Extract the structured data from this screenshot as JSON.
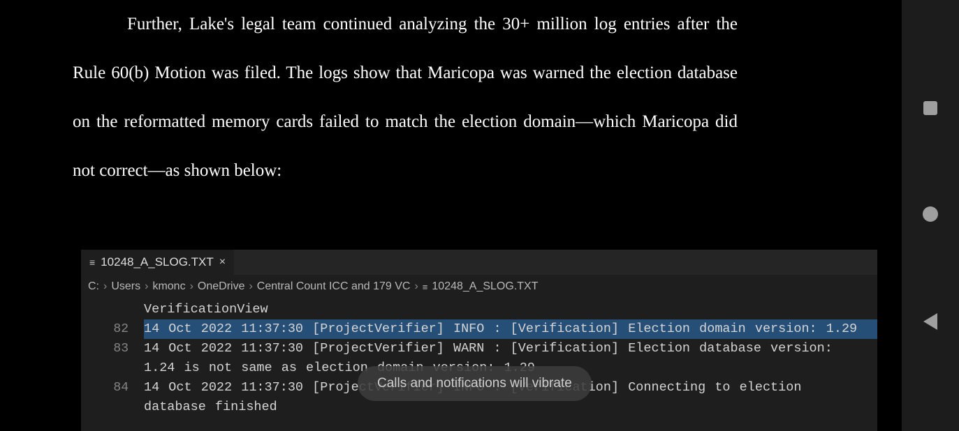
{
  "paragraph": {
    "text": "Further, Lake's legal team continued analyzing the 30+ million log entries after the Rule 60(b) Motion was filed. The logs show that Maricopa was warned the election database on the reformatted memory cards failed to match the election domain—which Maricopa did not correct—as shown below:"
  },
  "editor": {
    "tab": {
      "filename": "10248_A_SLOG.TXT"
    },
    "breadcrumbs": [
      "C:",
      "Users",
      "kmonc",
      "OneDrive",
      "Central Count ICC and 179 VC",
      "10248_A_SLOG.TXT"
    ],
    "lines": [
      {
        "num": "",
        "text": "VerificationView",
        "highlight": false,
        "cutoff": true
      },
      {
        "num": "82",
        "text": "14 Oct 2022 11:37:30 [ProjectVerifier] INFO : [Verification] Election domain version: 1.29",
        "highlight": true
      },
      {
        "num": "83",
        "text": "14 Oct 2022 11:37:30 [ProjectVerifier] WARN : [Verification] Election database version: 1.24 is not same as election domain version: 1.29",
        "highlight": false
      },
      {
        "num": "84",
        "text": "14 Oct 2022 11:37:30 [ProjectVerifier] INFO : [Verification] Connecting to election database finished",
        "highlight": false
      }
    ],
    "partial_top_line": "-- --- ---- --.--.-- [---- ------] ---- . [-------------] ------- --- --------- ----"
  },
  "toast": {
    "text": "Calls and notifications will vibrate"
  }
}
